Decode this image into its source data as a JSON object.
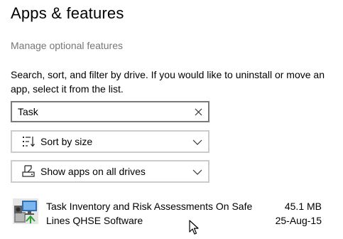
{
  "page": {
    "title": "Apps & features",
    "manage_link": "Manage optional features",
    "description": "Search, sort, and filter by drive. If you would like to uninstall or move an app, select it from the list."
  },
  "search": {
    "value": "Task",
    "clear_icon": "close-icon"
  },
  "sort": {
    "label": "Sort by size",
    "icon": "sort-icon",
    "chevron_icon": "chevron-down-icon"
  },
  "filter": {
    "label": "Show apps on all drives",
    "icon": "drive-icon",
    "chevron_icon": "chevron-down-icon"
  },
  "apps": [
    {
      "name": "Task Inventory and Risk Assessments On Safe Lines QHSE Software",
      "size": "45.1 MB",
      "date": "25-Aug-15",
      "icon": "installer-app-icon"
    }
  ],
  "colors": {
    "link_gray": "#767676",
    "search_border": "#7a7a7a",
    "dropdown_border": "#cccccc",
    "text": "#000000",
    "background": "#ffffff"
  }
}
